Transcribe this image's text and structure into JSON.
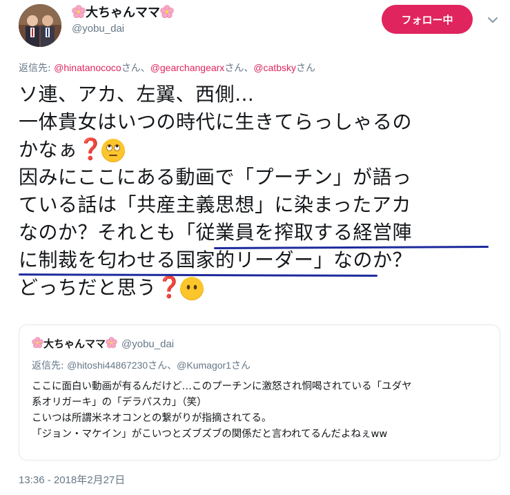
{
  "author": {
    "name": "大ちゃんママ",
    "handle": "@yobu_dai"
  },
  "follow_button": {
    "label": "フォロー中"
  },
  "reply_context": {
    "prefix": "返信先: ",
    "users": [
      "@hinatanococo",
      "@gearchangearx",
      "@catbsky"
    ],
    "suffix_each": "さん",
    "separator": "、"
  },
  "tweet": {
    "lines": [
      "ソ連、アカ、左翼、西側…",
      "一体貴女はいつの時代に生きてらっしゃるの",
      "かなぁ",
      "因みにここにある動画で「プーチン」が語っ",
      "ている話は「共産主義思想」に染まったアカ",
      "なのか？それとも「従業員を搾取する経営陣",
      "に制裁を匂わせる国家的リーダー」なのか？",
      "どっちだと思う"
    ]
  },
  "quoted_tweet": {
    "name": "大ちゃんママ",
    "handle": "@yobu_dai",
    "reply_prefix": "返信先: ",
    "reply_users": [
      "@hitoshi44867230",
      "@Kumagor1"
    ],
    "reply_suffix": "さん",
    "reply_separator": "、",
    "body_lines": [
      "ここに面白い動画が有るんだけど…このプーチンに激怒され恫喝されている「ユダヤ",
      "系オリガーキ」の「デラパスカ」（笑）",
      "こいつは所謂米ネオコンとの繋がりが指摘されてる。",
      "「ジョン・マケイン」がこいつとズブズブの関係だと言われてるんだよねぇww"
    ]
  },
  "timestamp": "13:36 - 2018年2月27日",
  "colors": {
    "follow_bg": "#e0245e",
    "link": "#e0245e",
    "underline": "#1c2a9c",
    "secondary_text": "#657786"
  },
  "icons": [
    "cherry-blossom-icon",
    "chevron-down-icon",
    "red-question-icon",
    "eye-roll-face-icon",
    "no-mouth-face-icon"
  ]
}
